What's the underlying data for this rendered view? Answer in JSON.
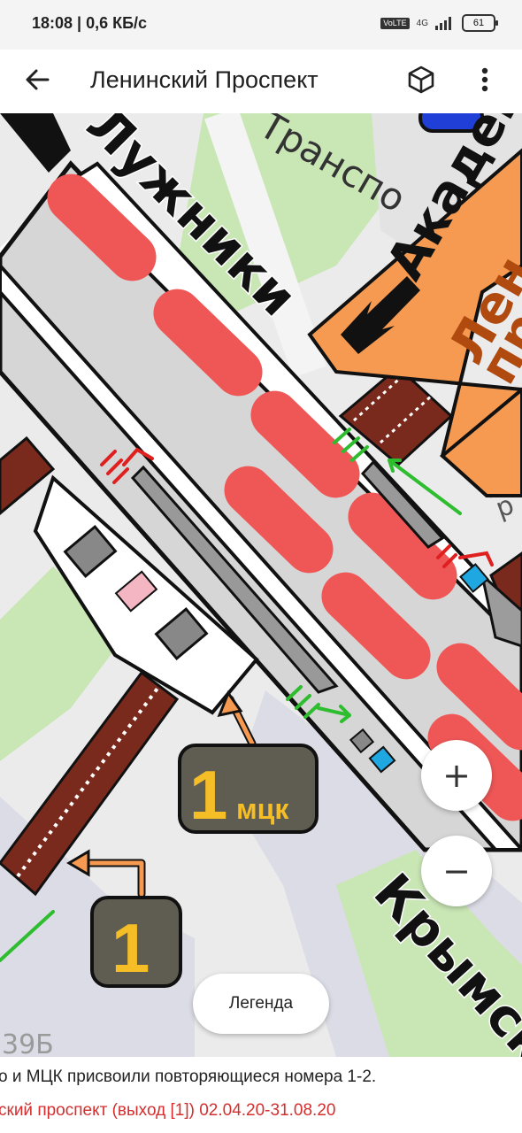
{
  "status_bar": {
    "time_speed": "18:08 | 0,6 КБ/с",
    "volte": "VoLTE",
    "network": "4G",
    "battery": "61"
  },
  "app_bar": {
    "title": "Ленинский Проспект",
    "back_icon": "arrow-back-icon",
    "cube_icon": "3d-cube-icon",
    "more_icon": "more-vert-icon"
  },
  "map": {
    "labels": {
      "luzhniki": "Лужники",
      "transport": "Транспо",
      "academic": "Академ",
      "leninsky_top": "Лен",
      "leninsky_bottom": "пр",
      "krymsky": "Крымск",
      "building_number": "39Б",
      "letter_r": "р"
    },
    "exit_badges": [
      {
        "number": "1",
        "suffix": "мцк"
      },
      {
        "number": "1",
        "suffix": ""
      }
    ],
    "colors": {
      "platform": "#ef5757",
      "orange_sign": "#f59a50",
      "badge_bg": "#5f5d52",
      "badge_text": "#f5be27",
      "stairs": "#7a2a1c",
      "green_arrow": "#2ebd2e",
      "red_arrow": "#e01f1f",
      "cyan": "#1ea7e0",
      "park": "#c9e6b5"
    }
  },
  "controls": {
    "zoom_in": "+",
    "zoom_out": "−",
    "legend": "Легенда"
  },
  "footer": {
    "notice": "о и МЦК присвоили повторяющиеся номера 1-2.",
    "closure": "ский проспект (выход [1]) 02.04.20-31.08.20"
  }
}
